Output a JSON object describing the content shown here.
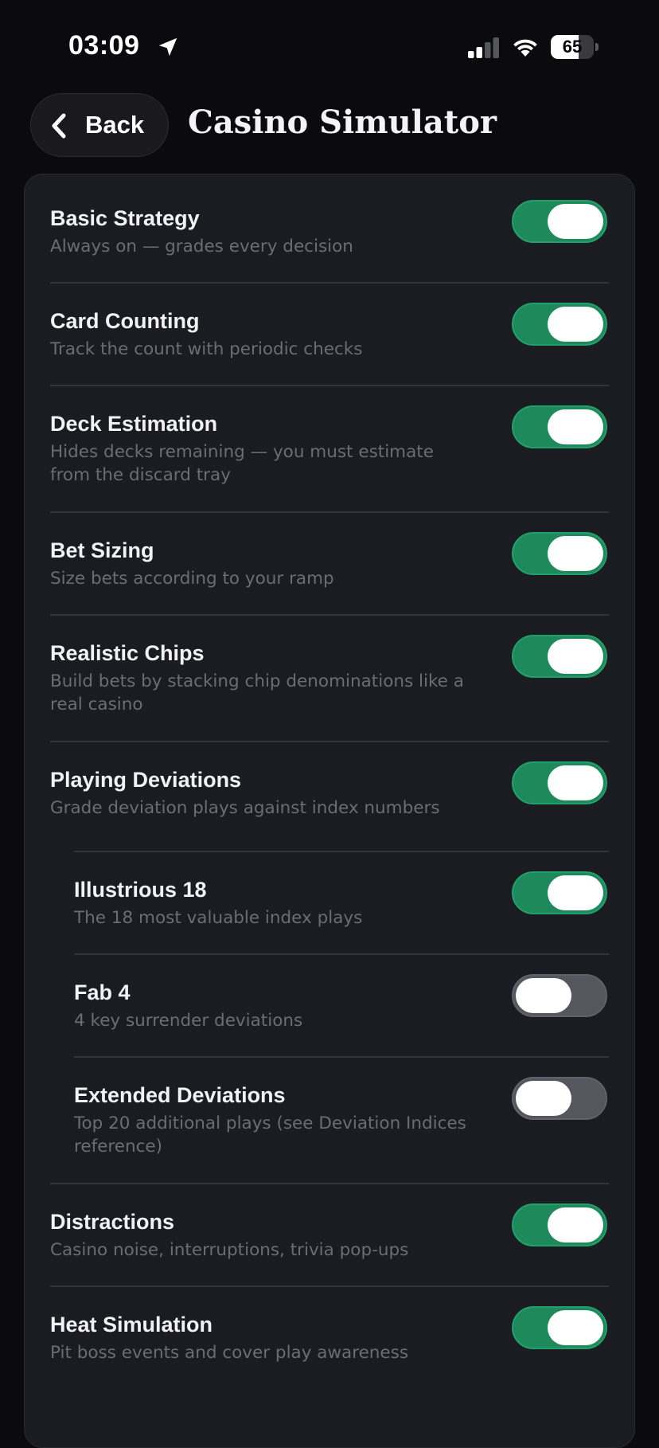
{
  "status_bar": {
    "time": "03:09",
    "battery_percent": 65,
    "battery_label": "65",
    "signal_bars_active": 2,
    "signal_bars_total": 4
  },
  "header": {
    "back_label": "Back",
    "title": "Casino Simulator"
  },
  "colors": {
    "toggle_on": "#1e8a5c",
    "toggle_off": "#55565e",
    "card_background": "#1b1c22",
    "page_background": "#0b0b0e"
  },
  "settings": [
    {
      "title": "Basic Strategy",
      "description": [
        "Always on — grades every decision"
      ],
      "enabled": true,
      "indented": false
    },
    {
      "title": "Card Counting",
      "description": [
        "Track the count with periodic checks"
      ],
      "enabled": true,
      "indented": false
    },
    {
      "title": "Deck Estimation",
      "description": [
        "Hides decks remaining — you must estimate",
        "from the discard tray"
      ],
      "enabled": true,
      "indented": false
    },
    {
      "title": "Bet Sizing",
      "description": [
        "Size bets according to your ramp"
      ],
      "enabled": true,
      "indented": false
    },
    {
      "title": "Realistic Chips",
      "description": [
        "Build bets by stacking chip denominations like a",
        "real casino"
      ],
      "enabled": true,
      "indented": false
    },
    {
      "title": "Playing Deviations",
      "description": [
        "Grade deviation plays against index numbers"
      ],
      "enabled": true,
      "indented": false
    },
    {
      "title": "Illustrious 18",
      "description": [
        "The 18 most valuable index plays"
      ],
      "enabled": true,
      "indented": true
    },
    {
      "title": "Fab 4",
      "description": [
        "4 key surrender deviations"
      ],
      "enabled": false,
      "indented": true
    },
    {
      "title": "Extended Deviations",
      "description": [
        "Top 20 additional plays (see Deviation Indices",
        "reference)"
      ],
      "enabled": false,
      "indented": true
    },
    {
      "title": "Distractions",
      "description": [
        "Casino noise, interruptions, trivia pop-ups"
      ],
      "enabled": true,
      "indented": false
    },
    {
      "title": "Heat Simulation",
      "description": [
        "Pit boss events and cover play awareness"
      ],
      "enabled": true,
      "indented": false
    }
  ]
}
